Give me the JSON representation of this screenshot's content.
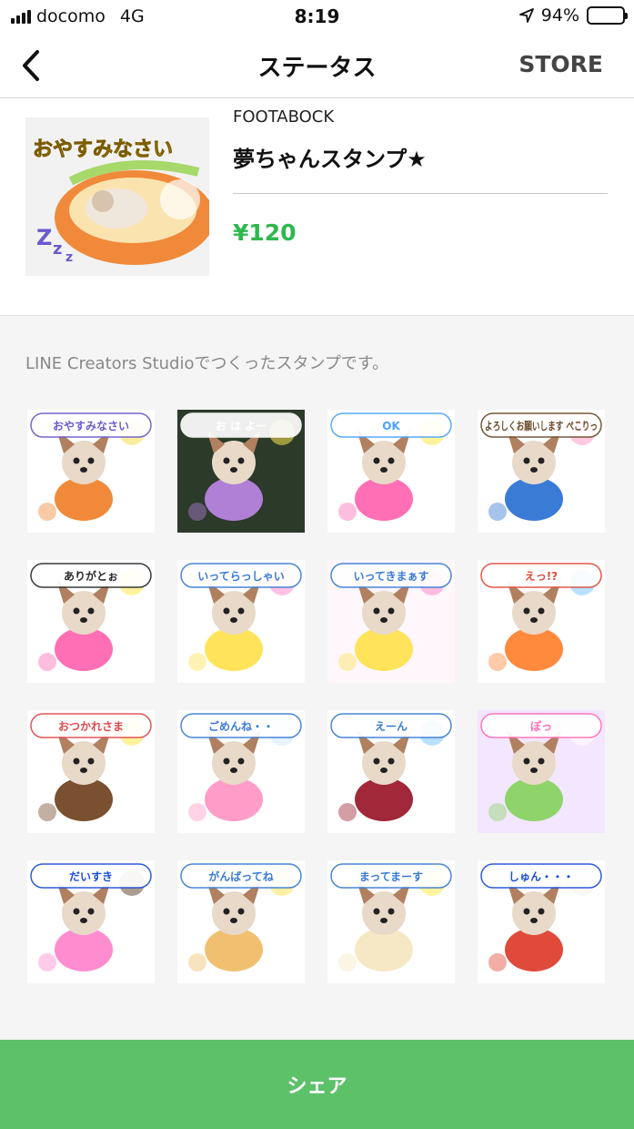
{
  "status_bar": {
    "carrier": "docomo",
    "network": "4G",
    "time": "8:19",
    "battery": "94%",
    "battery_level": 0.94
  },
  "nav": {
    "title": "ステータス",
    "store_label": "STORE",
    "back_icon": "chevron-left-icon"
  },
  "product": {
    "author": "FOOTABOCK",
    "name": "夢ちゃんスタンプ★",
    "price": "¥120",
    "thumbnail_caption": "おやすみなさい"
  },
  "creators_note": "LINE Creators Studioでつくったスタンプです。",
  "stickers": [
    {
      "caption": "おやすみなさい"
    },
    {
      "caption": "お は よー"
    },
    {
      "caption": "OK"
    },
    {
      "caption": "よろしくお願いします ぺこりっ"
    },
    {
      "caption": "ありがとぉ"
    },
    {
      "caption": "いってらっしゃい"
    },
    {
      "caption": "いってきまぁす"
    },
    {
      "caption": "えっ!?"
    },
    {
      "caption": "おつかれさま"
    },
    {
      "caption": "ごめんね・・"
    },
    {
      "caption": "えーん"
    },
    {
      "caption": "ぽっ"
    },
    {
      "caption": "だいすき"
    },
    {
      "caption": "がんばってね"
    },
    {
      "caption": "まってまーす"
    },
    {
      "caption": "しゅん・・・"
    }
  ],
  "share_label": "シェア",
  "colors": {
    "price": "#2fb84e",
    "share_button": "#5dc16a",
    "background_gray": "#f5f5f5"
  }
}
